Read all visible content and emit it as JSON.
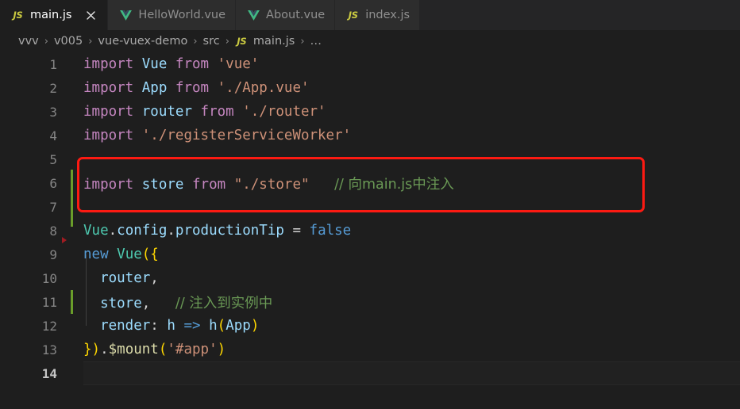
{
  "window": {
    "app": "Visual Studio Code",
    "theme_bg": "#1e1e1e",
    "tabbar_bg": "#252526"
  },
  "tabs": [
    {
      "label": "main.js",
      "icon": "js-file-icon",
      "active": true,
      "closable": true
    },
    {
      "label": "HelloWorld.vue",
      "icon": "vue-file-icon",
      "active": false,
      "closable": false
    },
    {
      "label": "About.vue",
      "icon": "vue-file-icon",
      "active": false,
      "closable": false
    },
    {
      "label": "index.js",
      "icon": "js-file-icon",
      "active": false,
      "closable": false
    }
  ],
  "breadcrumb": {
    "separator": "›",
    "items": [
      {
        "label": "vvv",
        "icon": ""
      },
      {
        "label": "v005",
        "icon": ""
      },
      {
        "label": "vue-vuex-demo",
        "icon": ""
      },
      {
        "label": "src",
        "icon": ""
      },
      {
        "label": "main.js",
        "icon": "js-file-icon"
      },
      {
        "label": "…",
        "icon": ""
      }
    ]
  },
  "editor": {
    "file": "main.js",
    "language": "javascript",
    "active_line": 14,
    "line_numbers": [
      "1",
      "2",
      "3",
      "4",
      "5",
      "6",
      "7",
      "8",
      "9",
      "10",
      "11",
      "12",
      "13",
      "14"
    ],
    "lines": [
      {
        "n": "1",
        "text": "import Vue from 'vue'"
      },
      {
        "n": "2",
        "text": "import App from './App.vue'"
      },
      {
        "n": "3",
        "text": "import router from './router'"
      },
      {
        "n": "4",
        "text": "import './registerServiceWorker'"
      },
      {
        "n": "5",
        "text": ""
      },
      {
        "n": "6",
        "text": "import store from \"./store\"   // 向main.js中注入"
      },
      {
        "n": "7",
        "text": ""
      },
      {
        "n": "8",
        "text": "Vue.config.productionTip = false"
      },
      {
        "n": "9",
        "text": "new Vue({"
      },
      {
        "n": "10",
        "text": "  router,"
      },
      {
        "n": "11",
        "text": "  store,   // 注入到实例中"
      },
      {
        "n": "12",
        "text": "  render: h => h(App)"
      },
      {
        "n": "13",
        "text": "}).$mount('#app')"
      },
      {
        "n": "14",
        "text": ""
      }
    ],
    "tokens": {
      "l1": {
        "kw_import": "import",
        "name": "Vue",
        "kw_from": "from",
        "str": "'vue'"
      },
      "l2": {
        "kw_import": "import",
        "name": "App",
        "kw_from": "from",
        "str": "'./App.vue'"
      },
      "l3": {
        "kw_import": "import",
        "name": "router",
        "kw_from": "from",
        "str": "'./router'"
      },
      "l4": {
        "kw_import": "import",
        "str": "'./registerServiceWorker'"
      },
      "l6": {
        "kw_import": "import",
        "name": "store",
        "kw_from": "from",
        "str": "\"./store\"",
        "comment": "// 向main.js中注入"
      },
      "l8": {
        "obj": "Vue",
        "dot1": ".",
        "p1": "config",
        "dot2": ".",
        "p2": "productionTip",
        "eq": "=",
        "val": "false"
      },
      "l9": {
        "kw_new": "new",
        "cls": "Vue",
        "open": "({"
      },
      "l10": {
        "prop": "router",
        "comma": ","
      },
      "l11": {
        "prop": "store",
        "comma": ",",
        "comment": "// 注入到实例中"
      },
      "l12": {
        "prop": "render",
        "colon": ":",
        "param": "h",
        "arrow": "=>",
        "call": "h",
        "arg": "App"
      },
      "l13": {
        "close": "})",
        "dot": ".",
        "method": "$mount",
        "str": "'#app'"
      }
    },
    "colors": {
      "keyword_import": "#c586c0",
      "keyword_control": "#569cd6",
      "identifier": "#9cdcfe",
      "type": "#4ec9b0",
      "string": "#ce9178",
      "comment": "#6a9955",
      "bracket1": "#ffd700",
      "bracket2": "#da70d6",
      "bracket3": "#179fff",
      "function": "#dcdcaa",
      "foreground": "#d4d4d4",
      "linenumber": "#858585",
      "linenumber_active": "#c6c6c6",
      "git_modified": "#6a9d2a",
      "annotation_red": "#fc1a12"
    },
    "gutter_markers": {
      "git_modified_lines": [
        "6",
        "7",
        "11"
      ],
      "fold_marker_line": "9"
    }
  },
  "annotation": {
    "type": "red-rectangle-highlight",
    "target_line": "6",
    "color": "#fc1a12"
  }
}
